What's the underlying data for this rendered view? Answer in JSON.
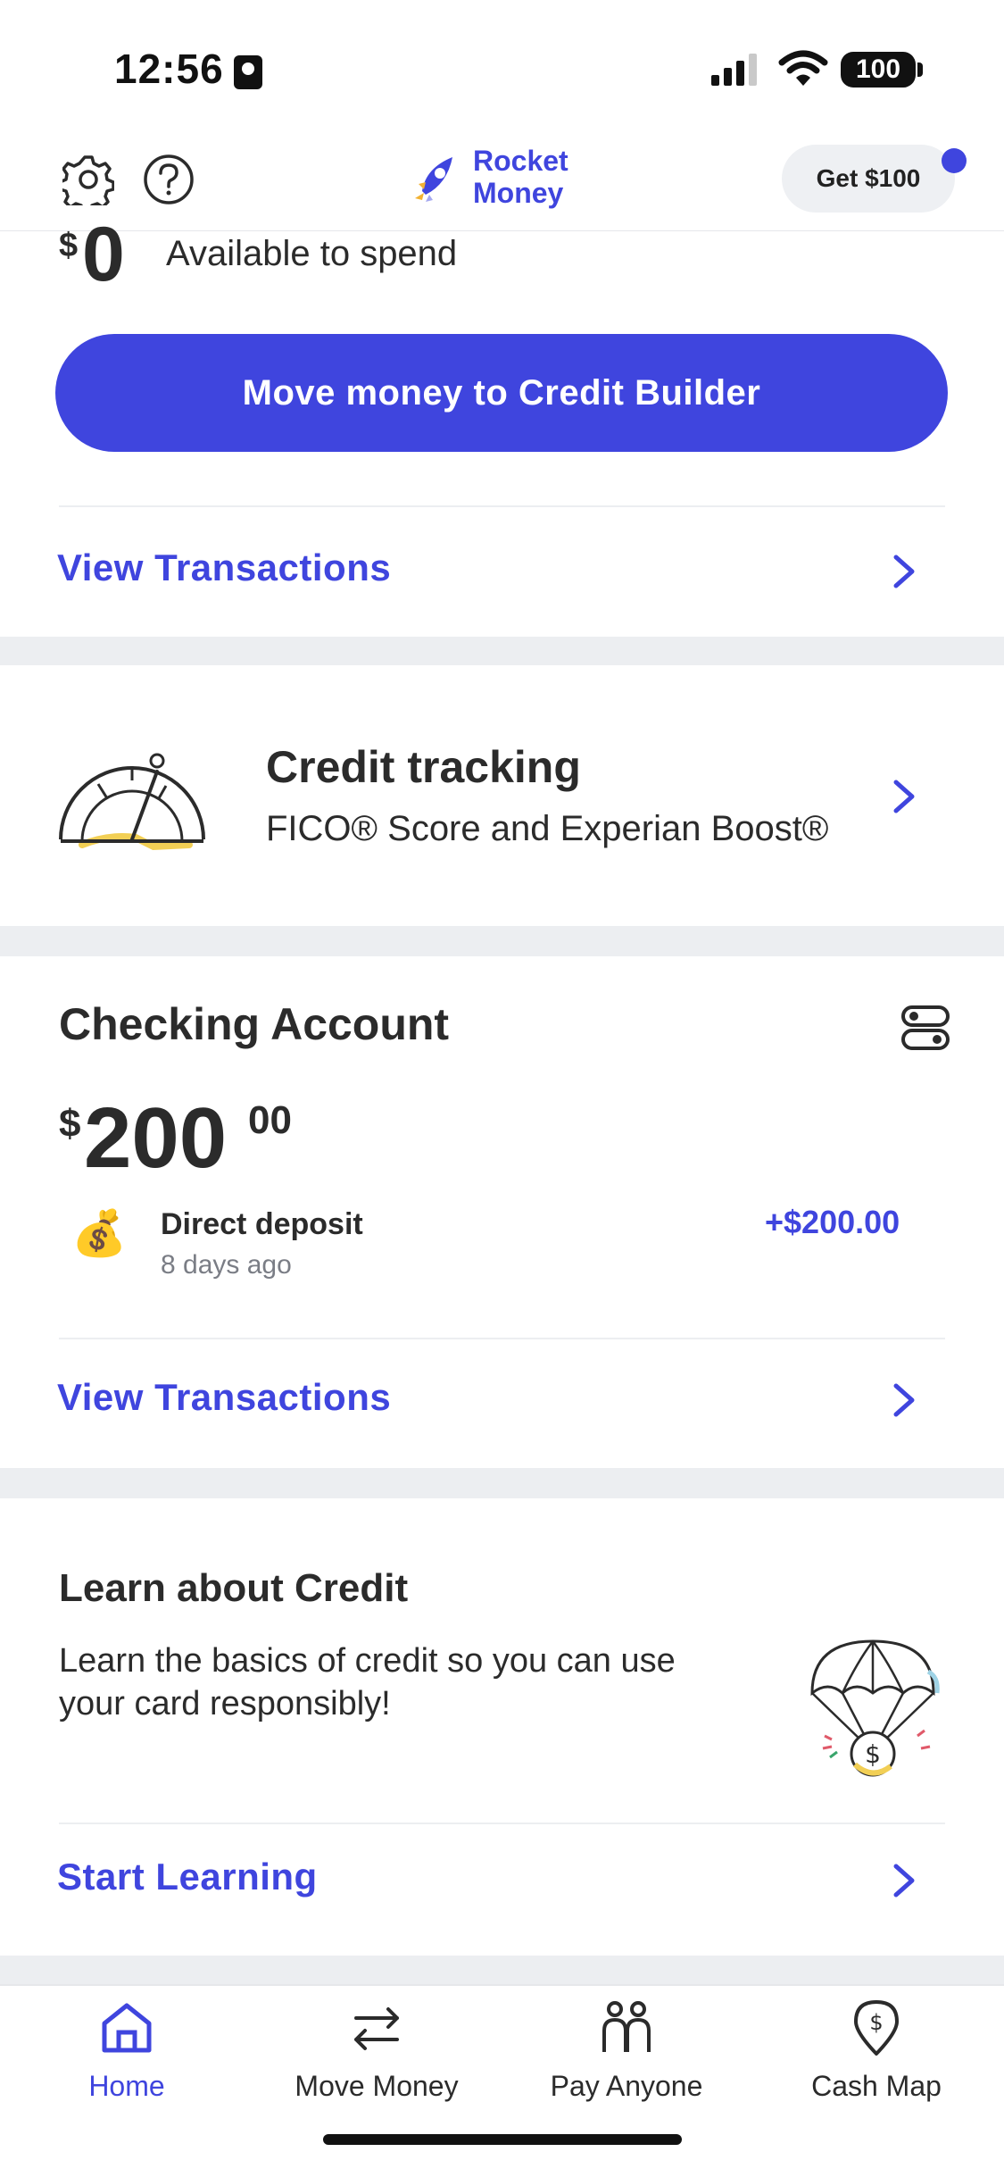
{
  "status_bar": {
    "time": "12:56",
    "battery": "100"
  },
  "header": {
    "logo_line1": "Rocket",
    "logo_line2": "Money",
    "promo_button": "Get $100"
  },
  "credit_builder": {
    "currency": "$",
    "amount": "0",
    "available_label": "Available to spend",
    "move_button": "Move money to Credit Builder",
    "view_transactions": "View Transactions"
  },
  "credit_tracking": {
    "title": "Credit tracking",
    "subtitle": "FICO® Score and Experian Boost®"
  },
  "checking": {
    "title": "Checking Account",
    "currency": "$",
    "balance_whole": "200",
    "balance_cents": "00",
    "transaction": {
      "emoji": "💰",
      "name": "Direct deposit",
      "time": "8 days ago",
      "amount": "+$200.00"
    },
    "view_transactions": "View Transactions"
  },
  "learn": {
    "title": "Learn about Credit",
    "body": "Learn the basics of credit so you can use your card responsibly!",
    "cta": "Start Learning"
  },
  "tabs": [
    {
      "label": "Home",
      "icon": "home-icon",
      "active": true
    },
    {
      "label": "Move Money",
      "icon": "transfer-arrows-icon",
      "active": false
    },
    {
      "label": "Pay Anyone",
      "icon": "people-icon",
      "active": false
    },
    {
      "label": "Cash Map",
      "icon": "map-pin-dollar-icon",
      "active": false
    }
  ],
  "colors": {
    "accent": "#3f45de",
    "text": "#2b2b2b",
    "muted": "#7a7d85",
    "separator": "#eceef1"
  }
}
